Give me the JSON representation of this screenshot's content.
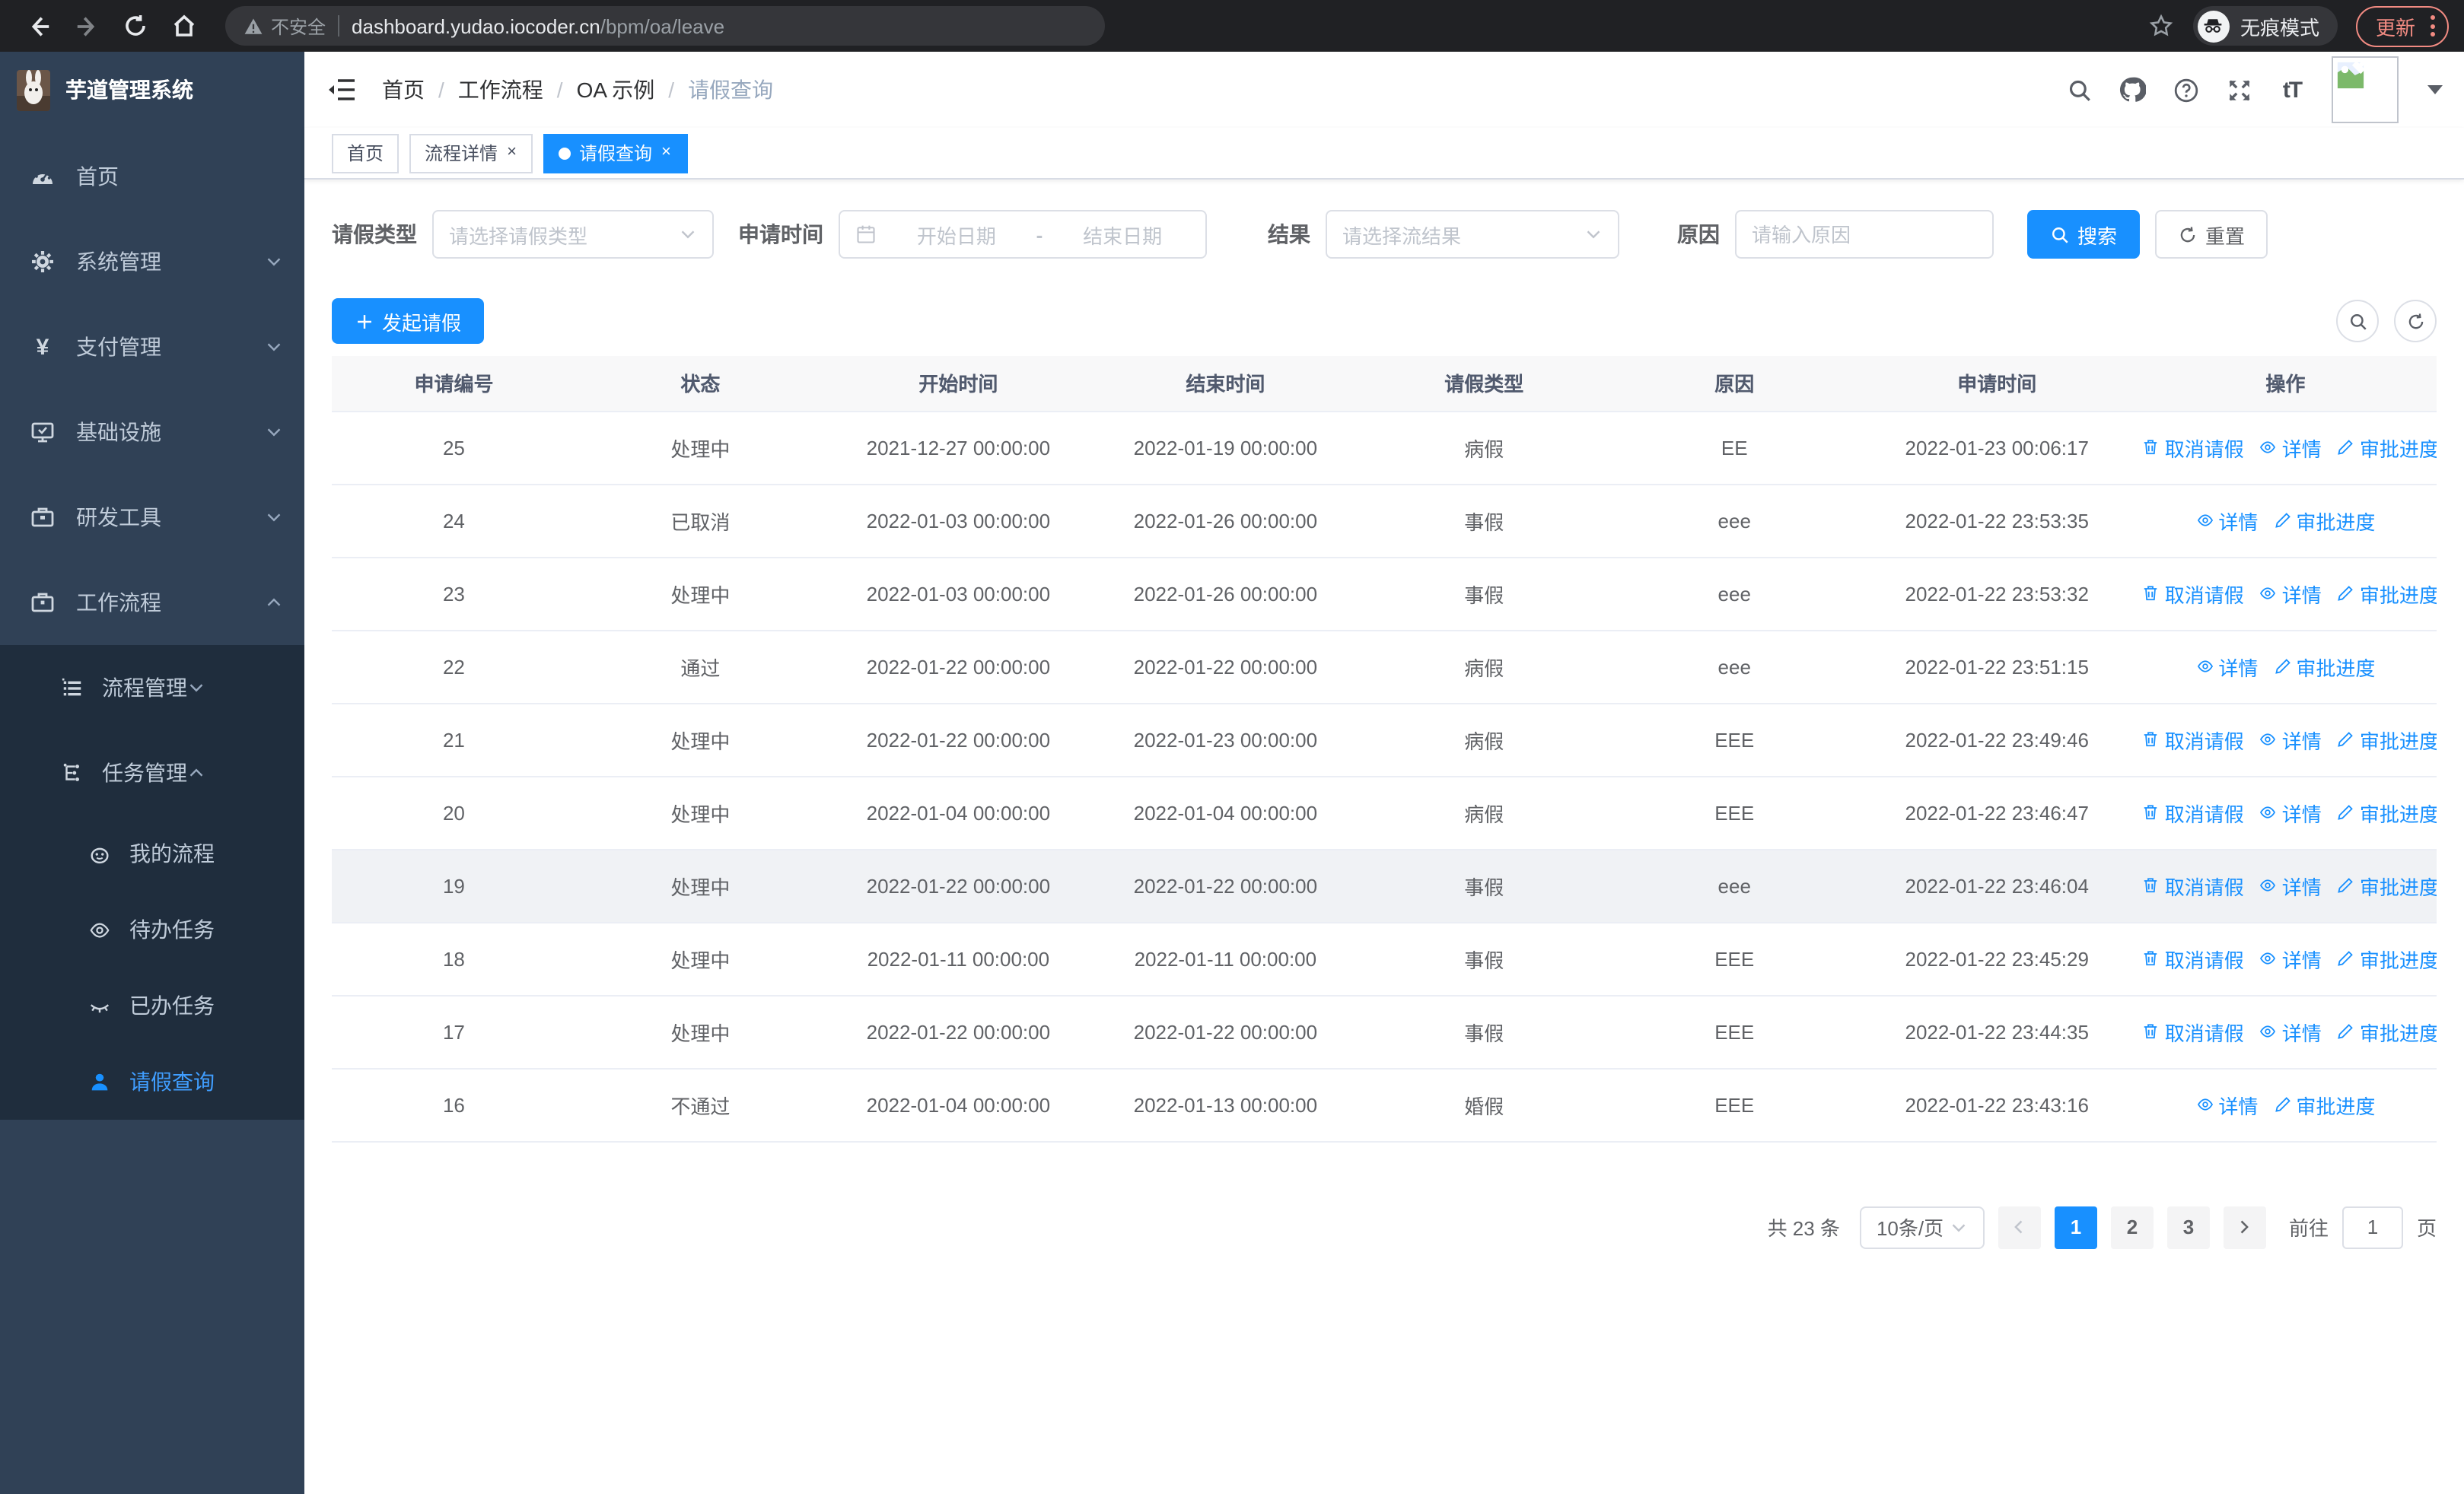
{
  "browser": {
    "security_label": "不安全",
    "url_domain": "dashboard.yudao.iocoder.cn",
    "url_path": "/bpm/oa/leave",
    "incognito_label": "无痕模式",
    "update_label": "更新"
  },
  "colors": {
    "accent": "#1890ff",
    "menu_active": "#409eff",
    "sidebar_bg": "#304156",
    "submenu_bg": "#1f2d3d",
    "update_red": "#f28b82"
  },
  "sidebar": {
    "title": "芋道管理系统",
    "items": [
      {
        "label": "首页",
        "icon": "dashboard-icon"
      },
      {
        "label": "系统管理",
        "icon": "gear-icon",
        "chevron": "down"
      },
      {
        "label": "支付管理",
        "icon": "yen-icon",
        "chevron": "down"
      },
      {
        "label": "基础设施",
        "icon": "monitor-icon",
        "chevron": "down"
      },
      {
        "label": "研发工具",
        "icon": "toolbox-icon",
        "chevron": "down"
      },
      {
        "label": "工作流程",
        "icon": "briefcase-icon",
        "chevron": "up",
        "expanded": true
      }
    ],
    "submenu": [
      {
        "label": "流程管理",
        "icon": "list-icon",
        "chevron": "down"
      },
      {
        "label": "任务管理",
        "icon": "tree-icon",
        "chevron": "up"
      },
      {
        "label": "我的流程",
        "icon": "face-icon"
      },
      {
        "label": "待办任务",
        "icon": "eye-open-icon"
      },
      {
        "label": "已办任务",
        "icon": "eye-closed-icon"
      },
      {
        "label": "请假查询",
        "icon": "user-icon",
        "active": true
      }
    ]
  },
  "header": {
    "breadcrumb": [
      "首页",
      "工作流程",
      "OA 示例",
      "请假查询"
    ]
  },
  "tabs": [
    {
      "label": "首页",
      "closable": false,
      "active": false
    },
    {
      "label": "流程详情",
      "closable": true,
      "active": false
    },
    {
      "label": "请假查询",
      "closable": true,
      "active": true
    }
  ],
  "filters": {
    "leave_type_label": "请假类型",
    "leave_type_placeholder": "请选择请假类型",
    "apply_time_label": "申请时间",
    "start_date_placeholder": "开始日期",
    "range_separator": "-",
    "end_date_placeholder": "结束日期",
    "result_label": "结果",
    "result_placeholder": "请选择流结果",
    "reason_label": "原因",
    "reason_placeholder": "请输入原因",
    "search_label": "搜索",
    "reset_label": "重置"
  },
  "toolbar": {
    "create_label": "发起请假"
  },
  "actions": {
    "cancel_label": "取消请假",
    "detail_label": "详情",
    "progress_label": "审批进度"
  },
  "table": {
    "columns": [
      "申请编号",
      "状态",
      "开始时间",
      "结束时间",
      "请假类型",
      "原因",
      "申请时间",
      "操作"
    ],
    "rows": [
      {
        "id": "25",
        "status": "处理中",
        "start_time": "2021-12-27 00:00:00",
        "end_time": "2022-01-19 00:00:00",
        "leave_type": "病假",
        "reason": "EE",
        "apply_time": "2022-01-23 00:06:17",
        "actions": [
          "cancel",
          "detail",
          "progress"
        ],
        "highlight": false
      },
      {
        "id": "24",
        "status": "已取消",
        "start_time": "2022-01-03 00:00:00",
        "end_time": "2022-01-26 00:00:00",
        "leave_type": "事假",
        "reason": "eee",
        "apply_time": "2022-01-22 23:53:35",
        "actions": [
          "detail",
          "progress"
        ],
        "highlight": false
      },
      {
        "id": "23",
        "status": "处理中",
        "start_time": "2022-01-03 00:00:00",
        "end_time": "2022-01-26 00:00:00",
        "leave_type": "事假",
        "reason": "eee",
        "apply_time": "2022-01-22 23:53:32",
        "actions": [
          "cancel",
          "detail",
          "progress"
        ],
        "highlight": false
      },
      {
        "id": "22",
        "status": "通过",
        "start_time": "2022-01-22 00:00:00",
        "end_time": "2022-01-22 00:00:00",
        "leave_type": "病假",
        "reason": "eee",
        "apply_time": "2022-01-22 23:51:15",
        "actions": [
          "detail",
          "progress"
        ],
        "highlight": false
      },
      {
        "id": "21",
        "status": "处理中",
        "start_time": "2022-01-22 00:00:00",
        "end_time": "2022-01-23 00:00:00",
        "leave_type": "病假",
        "reason": "EEE",
        "apply_time": "2022-01-22 23:49:46",
        "actions": [
          "cancel",
          "detail",
          "progress"
        ],
        "highlight": false
      },
      {
        "id": "20",
        "status": "处理中",
        "start_time": "2022-01-04 00:00:00",
        "end_time": "2022-01-04 00:00:00",
        "leave_type": "病假",
        "reason": "EEE",
        "apply_time": "2022-01-22 23:46:47",
        "actions": [
          "cancel",
          "detail",
          "progress"
        ],
        "highlight": false
      },
      {
        "id": "19",
        "status": "处理中",
        "start_time": "2022-01-22 00:00:00",
        "end_time": "2022-01-22 00:00:00",
        "leave_type": "事假",
        "reason": "eee",
        "apply_time": "2022-01-22 23:46:04",
        "actions": [
          "cancel",
          "detail",
          "progress"
        ],
        "highlight": true
      },
      {
        "id": "18",
        "status": "处理中",
        "start_time": "2022-01-11 00:00:00",
        "end_time": "2022-01-11 00:00:00",
        "leave_type": "事假",
        "reason": "EEE",
        "apply_time": "2022-01-22 23:45:29",
        "actions": [
          "cancel",
          "detail",
          "progress"
        ],
        "highlight": false
      },
      {
        "id": "17",
        "status": "处理中",
        "start_time": "2022-01-22 00:00:00",
        "end_time": "2022-01-22 00:00:00",
        "leave_type": "事假",
        "reason": "EEE",
        "apply_time": "2022-01-22 23:44:35",
        "actions": [
          "cancel",
          "detail",
          "progress"
        ],
        "highlight": false
      },
      {
        "id": "16",
        "status": "不通过",
        "start_time": "2022-01-04 00:00:00",
        "end_time": "2022-01-13 00:00:00",
        "leave_type": "婚假",
        "reason": "EEE",
        "apply_time": "2022-01-22 23:43:16",
        "actions": [
          "detail",
          "progress"
        ],
        "highlight": false
      }
    ]
  },
  "pagination": {
    "total_label": "共 23 条",
    "page_size_label": "10条/页",
    "pages": [
      "1",
      "2",
      "3"
    ],
    "active_page": "1",
    "goto_label": "前往",
    "goto_value": "1",
    "page_suffix": "页"
  }
}
